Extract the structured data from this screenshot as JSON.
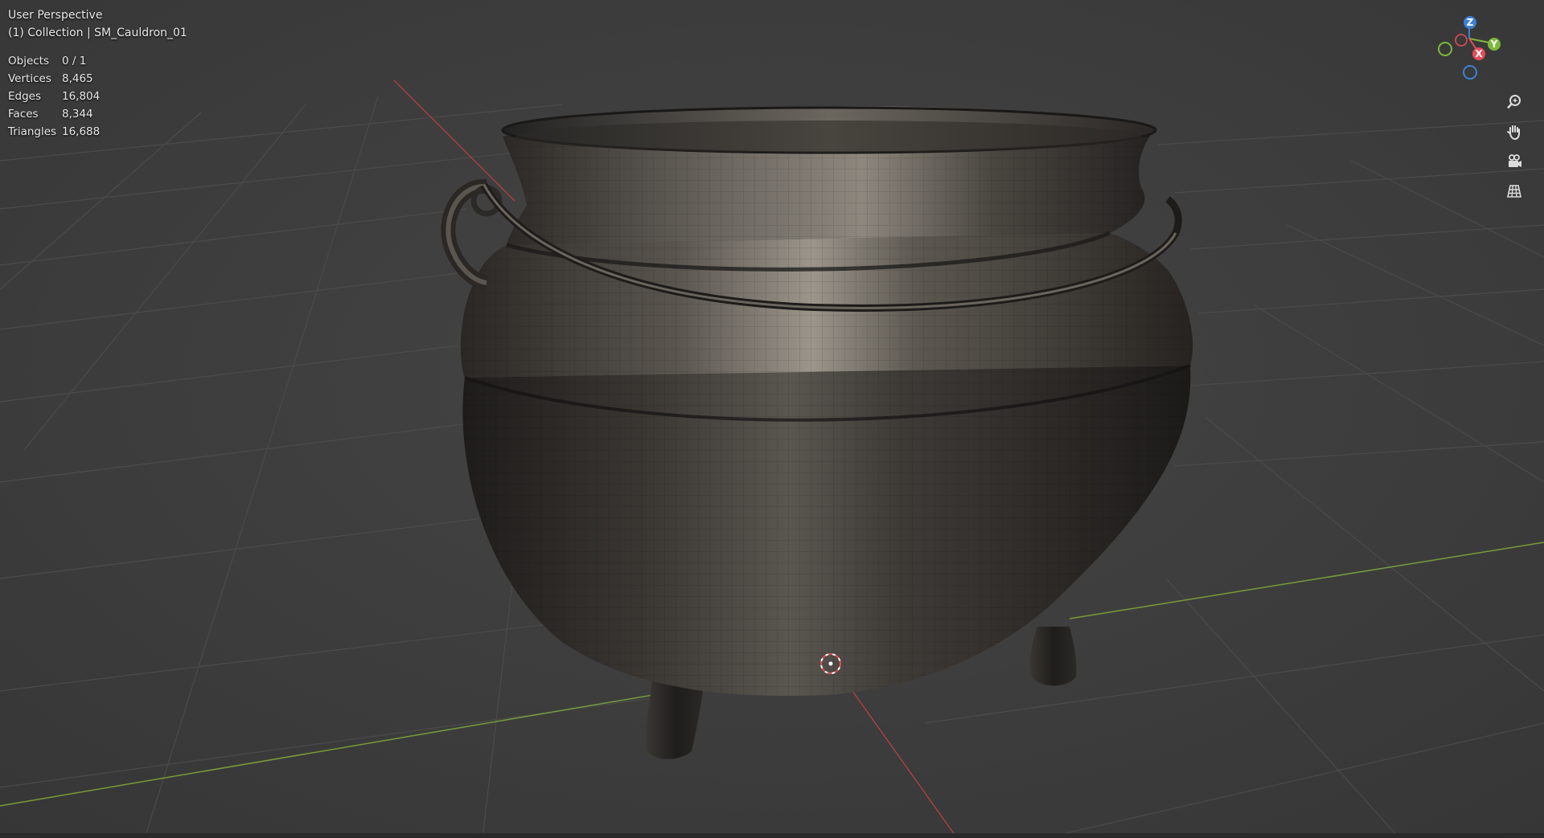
{
  "viewport": {
    "title": "User Perspective",
    "collection": "(1) Collection | SM_Cauldron_01",
    "stats": [
      {
        "label": "Objects",
        "value": "0 / 1"
      },
      {
        "label": "Vertices",
        "value": "8,465"
      },
      {
        "label": "Edges",
        "value": "16,804"
      },
      {
        "label": "Faces",
        "value": "8,344"
      },
      {
        "label": "Triangles",
        "value": "16,688"
      }
    ]
  },
  "gizmo": {
    "z_label": "Z",
    "y_label": "Y",
    "x_label": "X",
    "colors": {
      "x": "#e84b5a",
      "y": "#7eb83a",
      "z": "#3b80d4"
    }
  },
  "nav_icons": [
    "zoom-icon",
    "hand-pan-icon",
    "camera-icon",
    "grid-view-icon"
  ],
  "colors": {
    "background": "#3d3d3d",
    "grid": "#4a4a4a",
    "x_axis": "#b8403f",
    "y_axis": "#7a9b3a"
  }
}
